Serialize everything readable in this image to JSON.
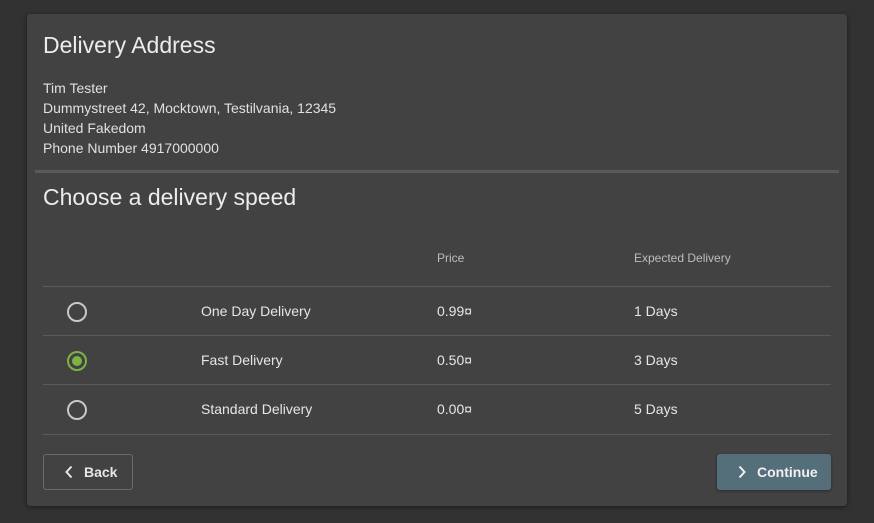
{
  "address": {
    "title": "Delivery Address",
    "name": "Tim Tester",
    "street": "Dummystreet 42, Mocktown, Testilvania, 12345",
    "country": "United Fakedom",
    "phone": "Phone Number 4917000000"
  },
  "delivery": {
    "title": "Choose a delivery speed",
    "headers": {
      "price": "Price",
      "expected": "Expected Delivery"
    },
    "options": [
      {
        "name": "One Day Delivery",
        "price": "0.99¤",
        "eta": "1 Days",
        "selected": false
      },
      {
        "name": "Fast Delivery",
        "price": "0.50¤",
        "eta": "3 Days",
        "selected": true
      },
      {
        "name": "Standard Delivery",
        "price": "0.00¤",
        "eta": "5 Days",
        "selected": false
      }
    ],
    "accent_color": "#7cb342"
  },
  "actions": {
    "back_label": "Back",
    "back_icon": "chevron-left-icon",
    "continue_label": "Continue",
    "continue_icon": "chevron-right-icon",
    "continue_color": "#546e7a"
  }
}
